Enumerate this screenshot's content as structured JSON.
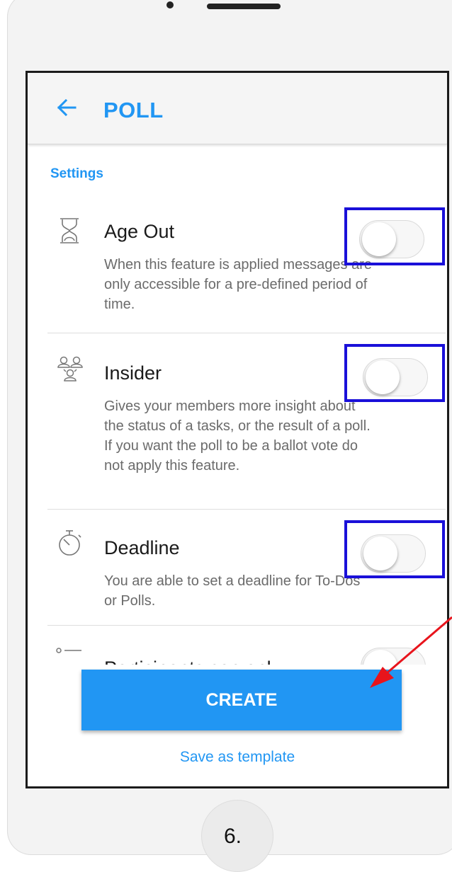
{
  "appbar": {
    "title": "POLL"
  },
  "section": {
    "title": "Settings"
  },
  "settings": [
    {
      "name": "Age Out",
      "description": "When this feature is applied messages are only accessible for a pre-defined period of time.",
      "icon": "hourglass-icon",
      "enabled": false
    },
    {
      "name": "Insider",
      "description": "Gives your members more insight about the status of a tasks, or the result of a poll. If you want the poll to be a ballot vote do not apply this feature.",
      "icon": "users-icon",
      "enabled": false
    },
    {
      "name": "Deadline",
      "description": "You are able to set a deadline for To-Dos or Polls.",
      "icon": "stopwatch-icon",
      "enabled": false
    }
  ],
  "partial_item": {
    "name": "Participants can only",
    "icon": "list-icon",
    "enabled": false
  },
  "actions": {
    "create_label": "CREATE",
    "template_label": "Save as template"
  },
  "annotations": {
    "page_number": "6.",
    "highlight_color": "#1a10d9",
    "arrow_color": "#e8141c"
  },
  "colors": {
    "accent": "#2196f3"
  }
}
